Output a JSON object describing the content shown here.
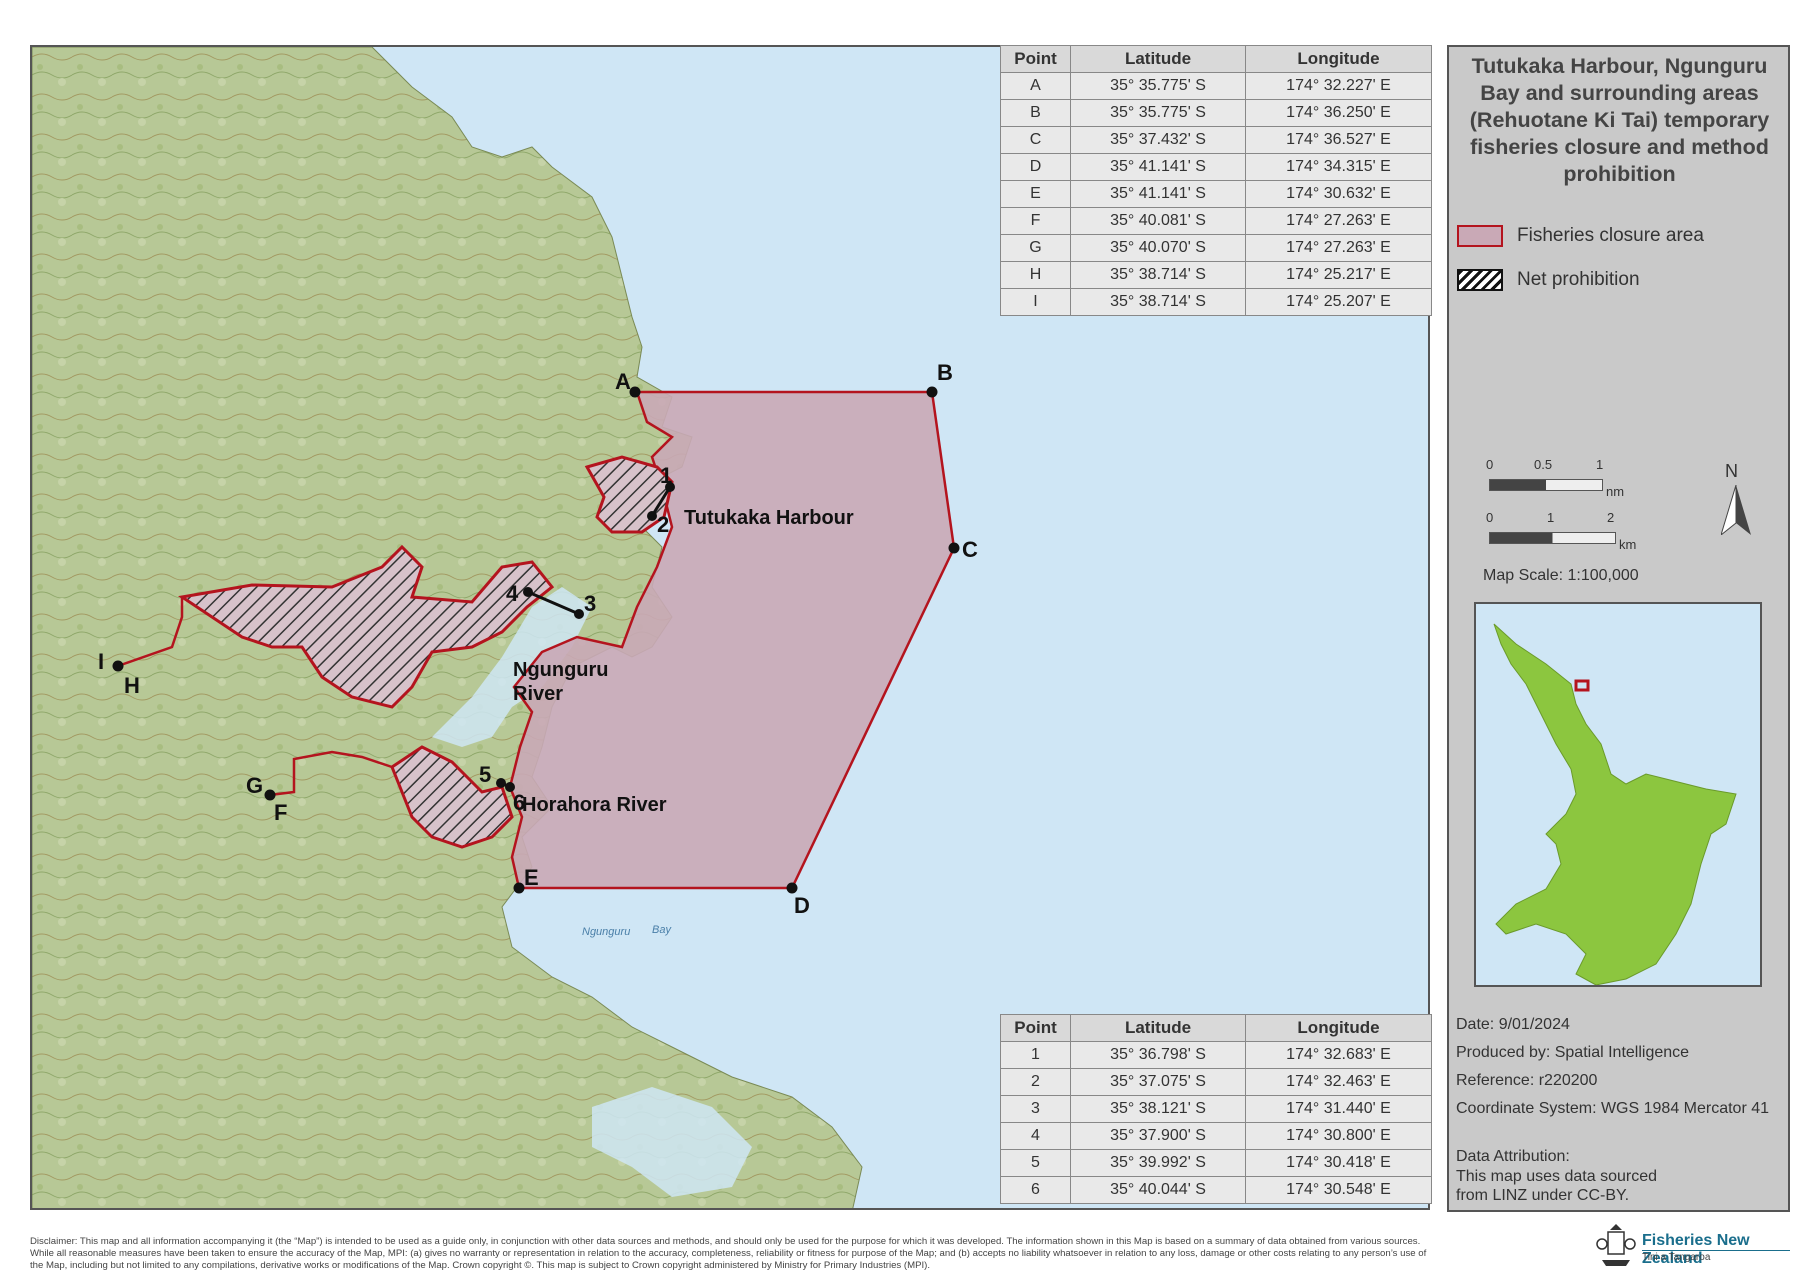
{
  "title": "Tutukaka Harbour, Ngunguru Bay and surrounding areas (Rehuotane Ki Tai) temporary fisheries closure and method prohibition",
  "legend": {
    "closure_label": "Fisheries closure area",
    "closure_fill": "#c9a9b6",
    "closure_stroke": "#b4141e",
    "net_label": "Net prohibition"
  },
  "corner_table": {
    "headers": [
      "Point",
      "Latitude",
      "Longitude"
    ],
    "rows": [
      [
        "A",
        "35° 35.775' S",
        "174° 32.227' E"
      ],
      [
        "B",
        "35° 35.775' S",
        "174° 36.250' E"
      ],
      [
        "C",
        "35° 37.432' S",
        "174° 36.527' E"
      ],
      [
        "D",
        "35° 41.141' S",
        "174° 34.315' E"
      ],
      [
        "E",
        "35° 41.141' S",
        "174° 30.632' E"
      ],
      [
        "F",
        "35° 40.081' S",
        "174° 27.263' E"
      ],
      [
        "G",
        "35° 40.070' S",
        "174° 27.263' E"
      ],
      [
        "H",
        "35° 38.714' S",
        "174° 25.217' E"
      ],
      [
        "I",
        "35° 38.714' S",
        "174° 25.207' E"
      ]
    ]
  },
  "net_table": {
    "headers": [
      "Point",
      "Latitude",
      "Longitude"
    ],
    "rows": [
      [
        "1",
        "35° 36.798' S",
        "174° 32.683' E"
      ],
      [
        "2",
        "35° 37.075' S",
        "174° 32.463' E"
      ],
      [
        "3",
        "35° 38.121' S",
        "174° 31.440' E"
      ],
      [
        "4",
        "35° 37.900' S",
        "174° 30.800' E"
      ],
      [
        "5",
        "35° 39.992' S",
        "174° 30.418' E"
      ],
      [
        "6",
        "35° 40.044' S",
        "174° 30.548' E"
      ]
    ]
  },
  "map_labels": {
    "tutukaka": "Tutukaka Harbour",
    "ngunguru_1": "Ngunguru",
    "ngunguru_2": "River",
    "horahora": "Horahora River",
    "ngunguru_bay_1": "Ngunguru",
    "ngunguru_bay_2": "Bay"
  },
  "scale": {
    "nm_ticks": [
      "0",
      "0.5",
      "1"
    ],
    "nm_unit": "nm",
    "km_ticks": [
      "0",
      "1",
      "2"
    ],
    "km_unit": "km",
    "map_scale": "Map Scale: 1:100,000",
    "north": "N"
  },
  "info": {
    "date": "Date: 9/01/2024",
    "produced": "Produced by: Spatial Intelligence",
    "reference": "Reference: r220200",
    "coord_system": "Coordinate System: WGS 1984 Mercator 41",
    "attribution_heading": "Data Attribution:",
    "attribution_text": "This map uses data sourced from LINZ under CC-BY."
  },
  "disclaimer": "Disclaimer: This map and all information accompanying it (the “Map”) is intended to be used as a guide only, in conjunction with other data sources and methods, and should only be used for the purpose for which it was developed. The information shown in this Map is based on a summary of data obtained from various sources. While all reasonable measures have been taken to ensure the accuracy of the Map, MPI: (a) gives no warranty or representation in relation to the accuracy, completeness, reliability or fitness for purpose of the Map; and (b) accepts no liability whatsoever in relation to any loss, damage or other costs relating to any person’s use of the Map, including but not limited to any compilations, derivative works or modifications of the Map. Crown copyright ©. This map is subject to Crown copyright administered by Ministry for Primary Industries (MPI).",
  "logo": {
    "name": "Fisheries New Zealand",
    "sub": "Tini a Tangaroa",
    "color": "#1a6e8c",
    "icon": "coat-of-arms-icon"
  },
  "colors": {
    "sea": "#cfe6f5",
    "land": "#b9c99a",
    "inset_land": "#8cc63f"
  }
}
